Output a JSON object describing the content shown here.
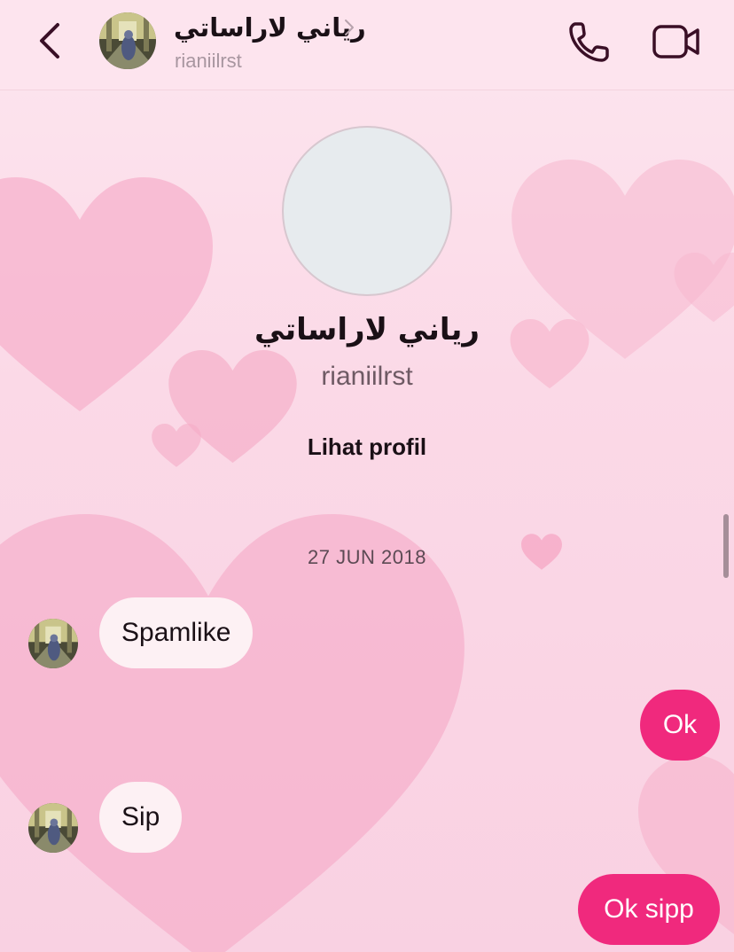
{
  "header": {
    "display_name": "رياني لاراساتي",
    "username": "rianiilrst",
    "icons": {
      "back": "chevron-left-icon",
      "call": "phone-icon",
      "video": "video-camera-icon",
      "more": "chevron-right-icon"
    }
  },
  "profile": {
    "display_name": "رياني لاراساتي",
    "username": "rianiilrst",
    "view_profile_label": "Lihat profil"
  },
  "conversation": {
    "date": "27 JUN 2018",
    "messages": [
      {
        "direction": "incoming",
        "text": "Spamlike"
      },
      {
        "direction": "outgoing",
        "text": "Ok"
      },
      {
        "direction": "incoming",
        "text": "Sip"
      },
      {
        "direction": "outgoing",
        "text": "Ok sipp"
      }
    ]
  },
  "colors": {
    "accent": "#f0297d",
    "incoming_bubble": "#fdf1f4",
    "header_icon": "#3a0f26",
    "theme_heart": "#f6a9c6"
  }
}
